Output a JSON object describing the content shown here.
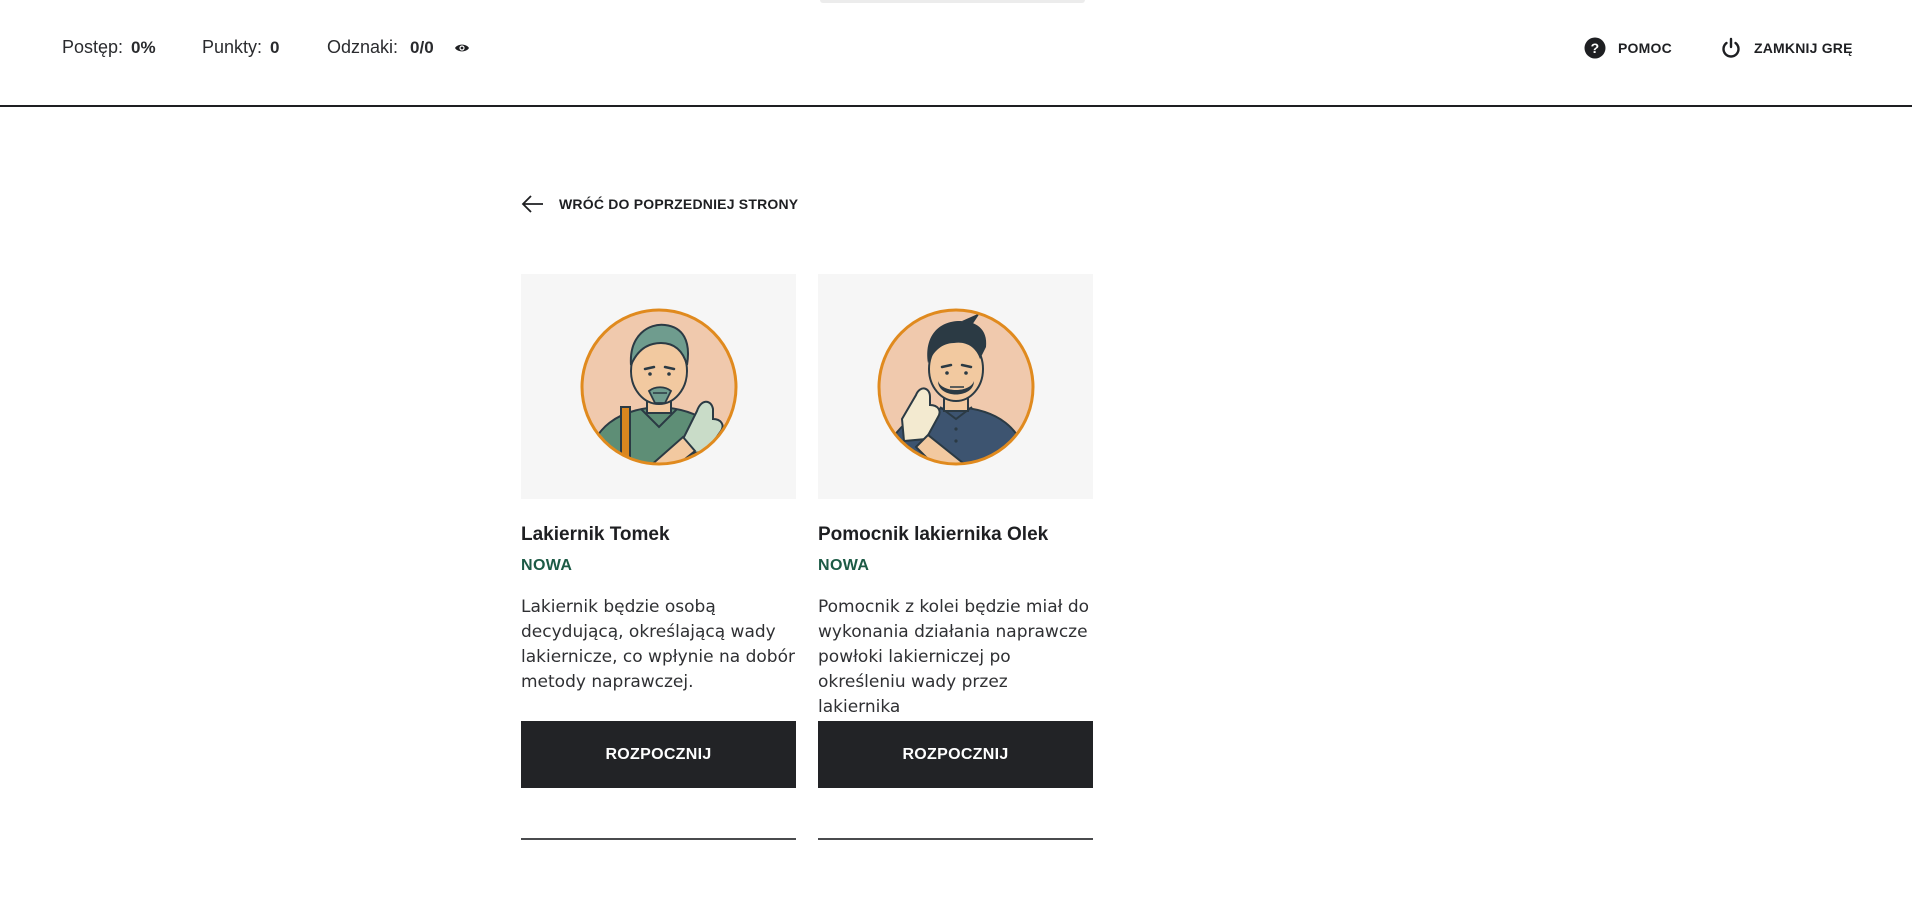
{
  "header": {
    "progress_label": "Postęp:",
    "progress_value": "0%",
    "points_label": "Punkty:",
    "points_value": "0",
    "badges_label": "Odznaki:",
    "badges_value": "0/0",
    "help_label": "POMOC",
    "close_label": "ZAMKNIJ GRĘ"
  },
  "back_label": "WRÓĆ DO POPRZEDNIEJ STRONY",
  "cards": [
    {
      "name": "Lakiernik Tomek",
      "badge": "NOWA",
      "description": "Lakiernik będzie osobą decydującą, określającą wady lakiernicze, co wpłynie na dobór metody naprawczej.",
      "button": "ROZPOCZNIJ"
    },
    {
      "name": "Pomocnik lakiernika Olek",
      "badge": "NOWA",
      "description": "Pomocnik z kolei będzie miał do wykonania działania naprawcze powłoki lakierniczej po określeniu wady przez lakiernika",
      "button": "ROZPOCZNIJ"
    }
  ],
  "colors": {
    "accent_dark": "#222326",
    "badge_green": "#1c5a45",
    "avatar_ring": "#e08a1e",
    "avatar_bg": "#f0c9ad"
  }
}
